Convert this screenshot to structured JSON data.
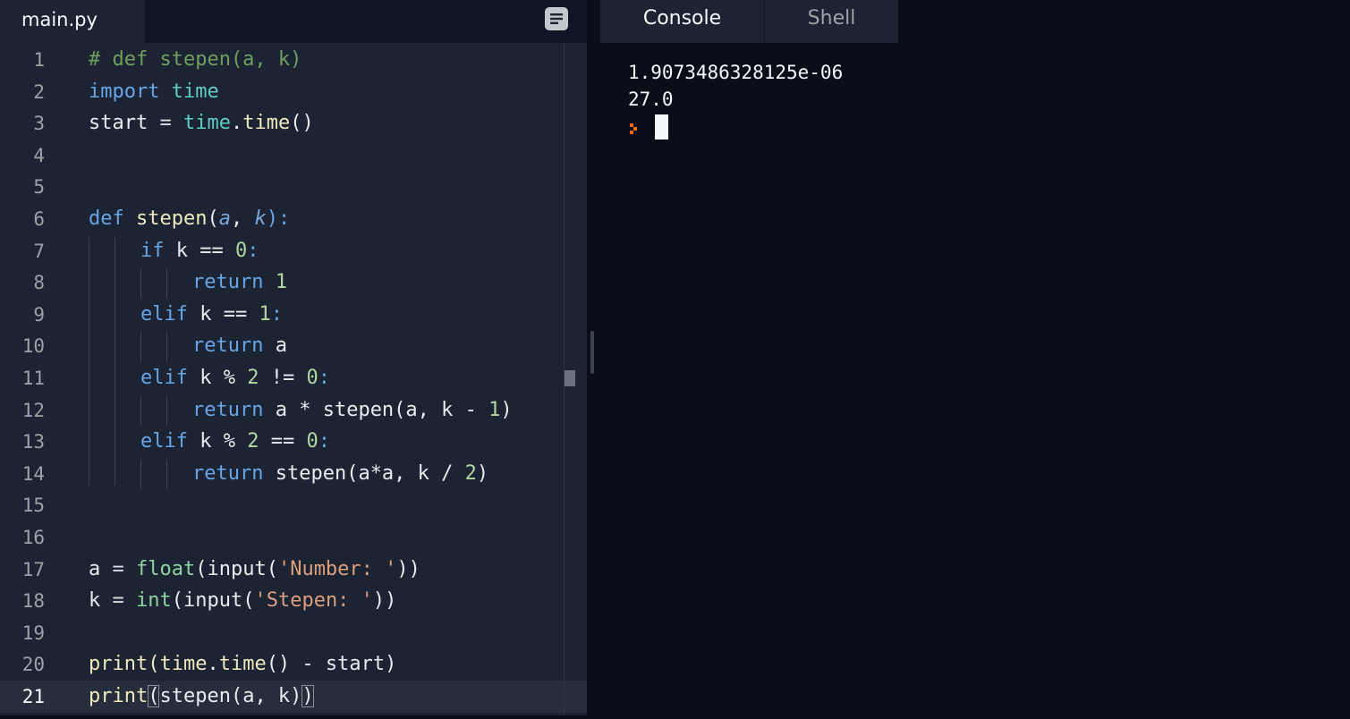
{
  "editor": {
    "file_tab": "main.py",
    "format_icon": "format-lines-icon",
    "active_line": 21,
    "lines": [
      [
        {
          "t": "# def stepen(a, k)",
          "c": "comment"
        }
      ],
      [
        {
          "t": "import",
          "c": "keyword"
        },
        {
          "t": " "
        },
        {
          "t": "time",
          "c": "module"
        }
      ],
      [
        {
          "t": "start "
        },
        {
          "t": "=",
          "c": "op"
        },
        {
          "t": " "
        },
        {
          "t": "time",
          "c": "module"
        },
        {
          "t": "."
        },
        {
          "t": "time",
          "c": "func"
        },
        {
          "t": "()"
        }
      ],
      [],
      [],
      [
        {
          "t": "def",
          "c": "keyword"
        },
        {
          "t": " "
        },
        {
          "t": "stepen",
          "c": "func"
        },
        {
          "t": "("
        },
        {
          "t": "a",
          "c": "param"
        },
        {
          "t": ", "
        },
        {
          "t": "k",
          "c": "param"
        },
        {
          "t": "):",
          "c": "keyword"
        }
      ],
      [
        {
          "t": "if",
          "c": "keyword"
        },
        {
          "t": " k == "
        },
        {
          "t": "0",
          "c": "number"
        },
        {
          "t": ":",
          "c": "keyword"
        }
      ],
      [
        {
          "t": "return",
          "c": "keyword"
        },
        {
          "t": " "
        },
        {
          "t": "1",
          "c": "number"
        }
      ],
      [
        {
          "t": "elif",
          "c": "keyword"
        },
        {
          "t": " k == "
        },
        {
          "t": "1",
          "c": "number"
        },
        {
          "t": ":",
          "c": "keyword"
        }
      ],
      [
        {
          "t": "return",
          "c": "keyword"
        },
        {
          "t": " a"
        }
      ],
      [
        {
          "t": "elif",
          "c": "keyword"
        },
        {
          "t": " k % "
        },
        {
          "t": "2",
          "c": "number"
        },
        {
          "t": " != "
        },
        {
          "t": "0",
          "c": "number"
        },
        {
          "t": ":",
          "c": "keyword"
        }
      ],
      [
        {
          "t": "return",
          "c": "keyword"
        },
        {
          "t": " a * stepen(a, k - "
        },
        {
          "t": "1",
          "c": "number"
        },
        {
          "t": ")"
        }
      ],
      [
        {
          "t": "elif",
          "c": "keyword"
        },
        {
          "t": " k % "
        },
        {
          "t": "2",
          "c": "number"
        },
        {
          "t": " == "
        },
        {
          "t": "0",
          "c": "number"
        },
        {
          "t": ":",
          "c": "keyword"
        }
      ],
      [
        {
          "t": "return",
          "c": "keyword"
        },
        {
          "t": " stepen(a*a, k / "
        },
        {
          "t": "2",
          "c": "number"
        },
        {
          "t": ")"
        }
      ],
      [],
      [],
      [
        {
          "t": "a "
        },
        {
          "t": "=",
          "c": "op"
        },
        {
          "t": " "
        },
        {
          "t": "float",
          "c": "builtin"
        },
        {
          "t": "(input("
        },
        {
          "t": "'Number: '",
          "c": "string"
        },
        {
          "t": "))"
        }
      ],
      [
        {
          "t": "k "
        },
        {
          "t": "=",
          "c": "op"
        },
        {
          "t": " "
        },
        {
          "t": "int",
          "c": "builtin"
        },
        {
          "t": "(input("
        },
        {
          "t": "'Stepen: '",
          "c": "string"
        },
        {
          "t": "))"
        }
      ],
      [],
      [
        {
          "t": "print(time",
          "c": "func"
        },
        {
          "t": "."
        },
        {
          "t": "time",
          "c": "func"
        },
        {
          "t": "() - start)"
        }
      ],
      [
        {
          "t": "print",
          "c": "func"
        },
        {
          "t": "(",
          "c": "bracket"
        },
        {
          "t": "stepen(a, k)"
        },
        {
          "t": ")",
          "c": "bracket"
        }
      ]
    ]
  },
  "console": {
    "tabs": [
      {
        "label": "Console",
        "active": true
      },
      {
        "label": "Shell",
        "active": false
      }
    ],
    "output": [
      "1.9073486328125e-06",
      "27.0"
    ],
    "prompt_icon": "prompt-chevron-icon",
    "prompt_color": "#f26522"
  },
  "colors": {
    "editor_bg": "#1c2333",
    "console_bg": "#0b0e19",
    "text": "#f5f9fc"
  }
}
